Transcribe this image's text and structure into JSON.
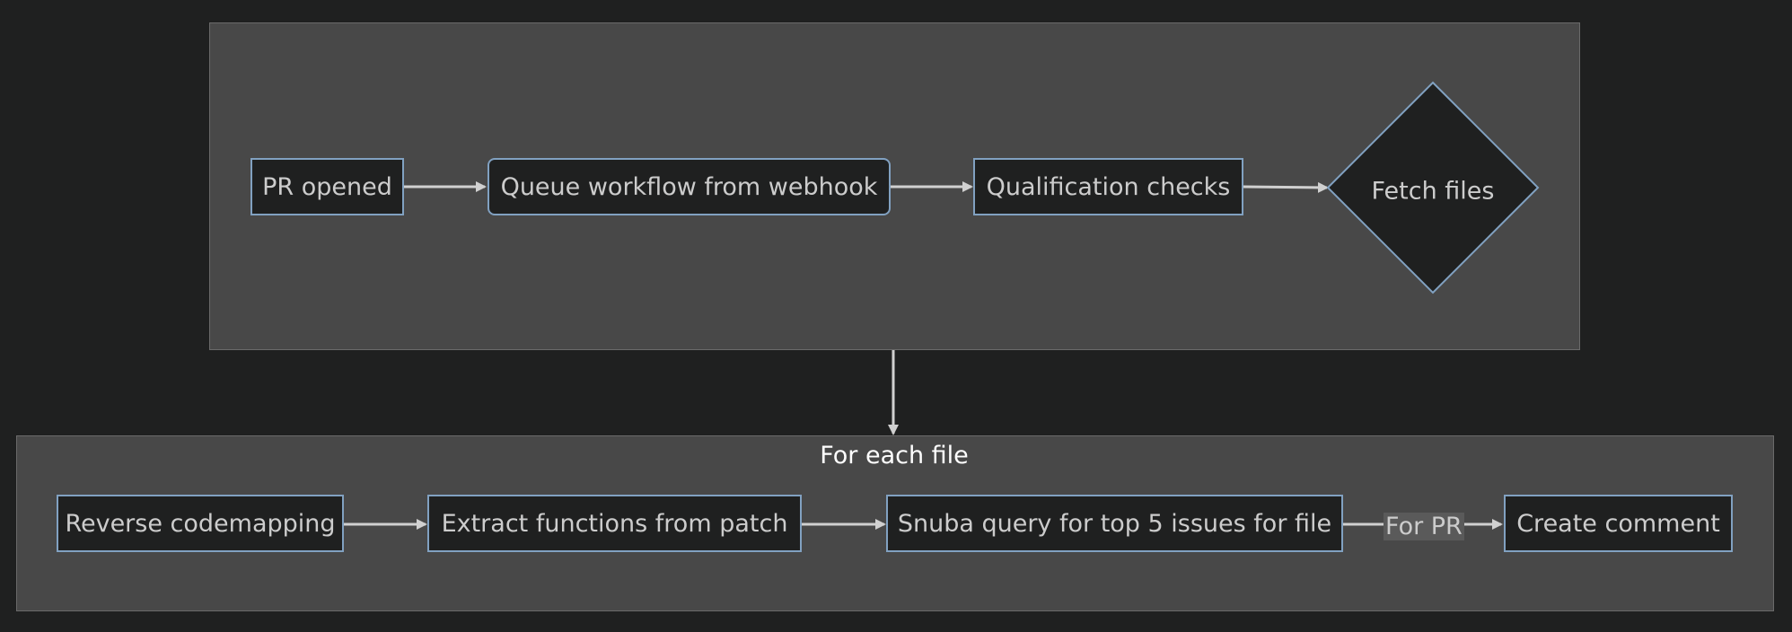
{
  "clusters": {
    "top": {
      "title": ""
    },
    "bottom": {
      "title": "For each file"
    }
  },
  "nodes": {
    "pr_opened": "PR opened",
    "queue_workflow": "Queue workflow from webhook",
    "qualification_checks": "Qualification checks",
    "fetch_files": "Fetch files",
    "reverse_codemapping": "Reverse codemapping",
    "extract_functions": "Extract functions from patch",
    "snuba_query": "Snuba query for top 5 issues for file",
    "create_comment": "Create comment"
  },
  "edge_labels": {
    "snuba_to_comment": "For PR"
  },
  "colors": {
    "background": "#1f2020",
    "cluster_fill": "#484848",
    "node_border": "#81a1c1",
    "edge": "#d0d0d0"
  }
}
